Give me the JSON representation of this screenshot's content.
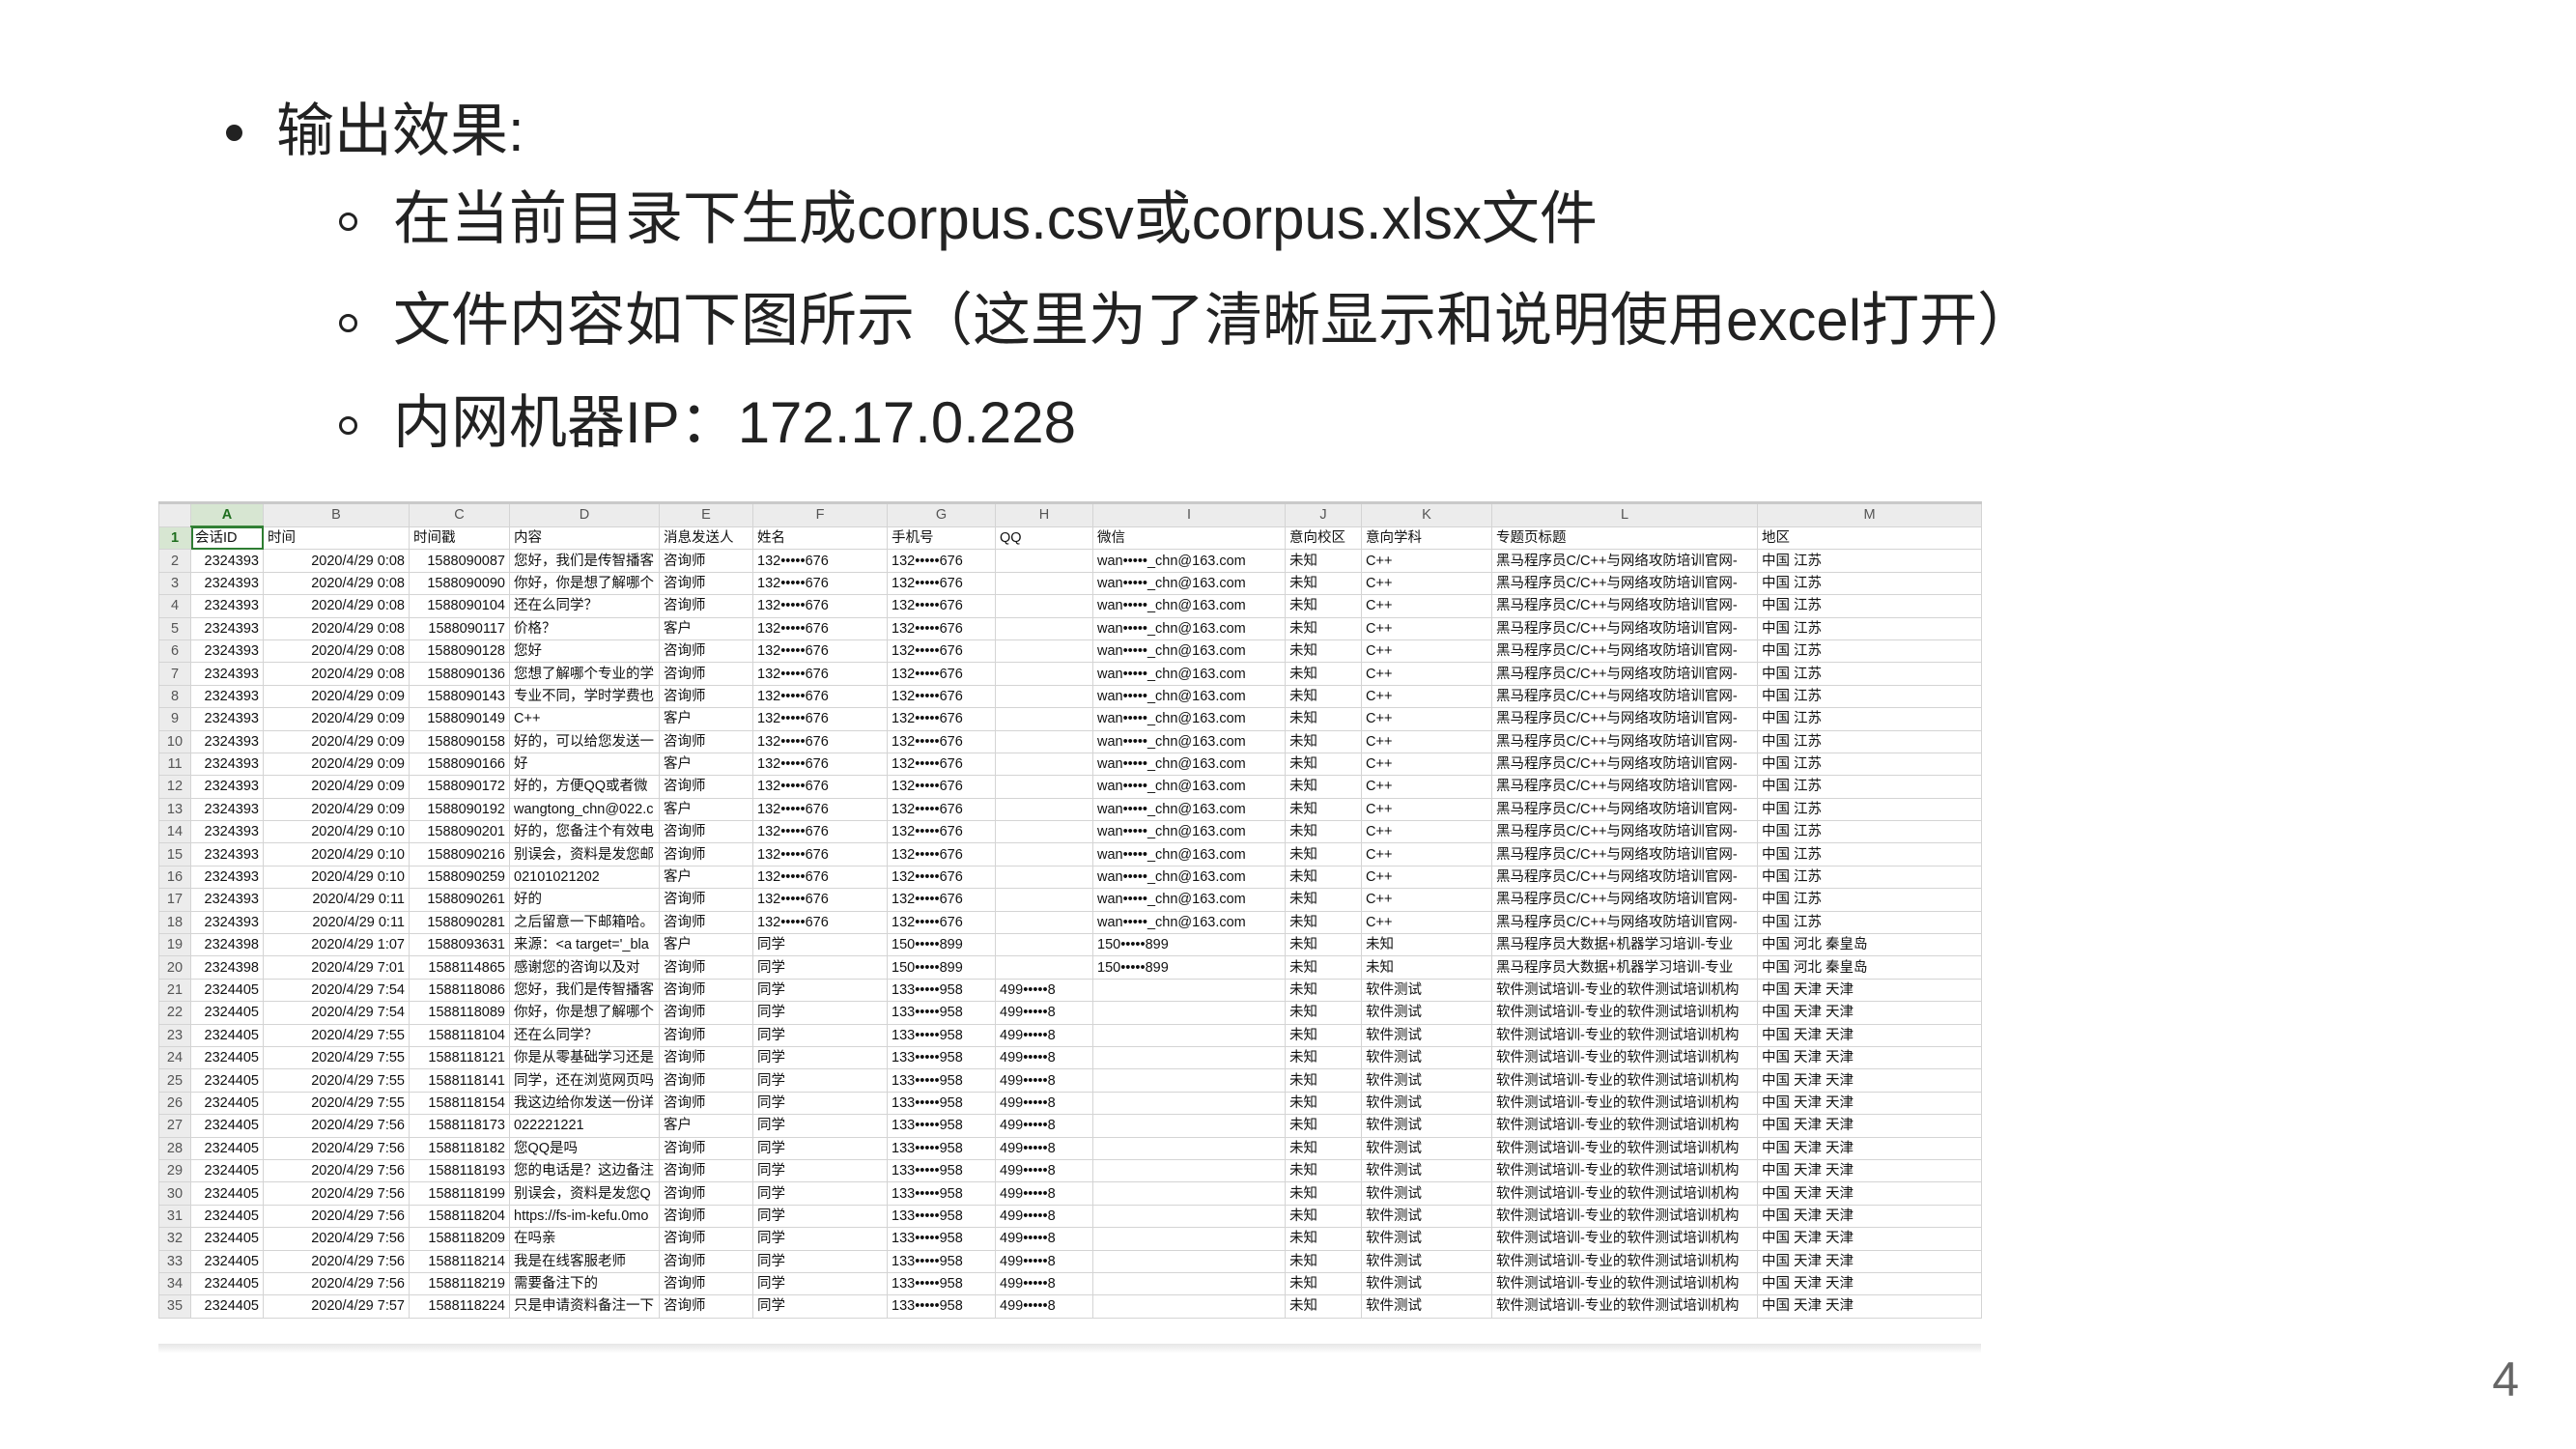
{
  "bullets": {
    "main": "输出效果:",
    "sub": [
      "在当前目录下生成corpus.csv或corpus.xlsx文件",
      "文件内容如下图所示（这里为了清晰显示和说明使用excel打开）",
      "内网机器IP：172.17.0.228"
    ]
  },
  "sheet": {
    "col_letters": [
      "A",
      "B",
      "C",
      "D",
      "E",
      "F",
      "G",
      "H",
      "I",
      "J",
      "K",
      "L",
      "M"
    ],
    "headers": [
      "会话ID",
      "时间",
      "时间戳",
      "内容",
      "消息发送人",
      "姓名",
      "手机号",
      "QQ",
      "微信",
      "意向校区",
      "意向学科",
      "专题页标题",
      "地区"
    ],
    "rows": [
      [
        "2324393",
        "2020/4/29 0:08",
        "1588090087",
        "您好，我们是传智播客",
        "咨询师",
        "132•••••676",
        "132•••••676",
        "",
        "wan•••••_chn@163.com",
        "未知",
        "C++",
        "黑马程序员C/C++与网络攻防培训官网-",
        "中国 江苏"
      ],
      [
        "2324393",
        "2020/4/29 0:08",
        "1588090090",
        "你好，你是想了解哪个",
        "咨询师",
        "132•••••676",
        "132•••••676",
        "",
        "wan•••••_chn@163.com",
        "未知",
        "C++",
        "黑马程序员C/C++与网络攻防培训官网-",
        "中国 江苏"
      ],
      [
        "2324393",
        "2020/4/29 0:08",
        "1588090104",
        "还在么同学？",
        "咨询师",
        "132•••••676",
        "132•••••676",
        "",
        "wan•••••_chn@163.com",
        "未知",
        "C++",
        "黑马程序员C/C++与网络攻防培训官网-",
        "中国 江苏"
      ],
      [
        "2324393",
        "2020/4/29 0:08",
        "1588090117",
        "价格？",
        "客户",
        "132•••••676",
        "132•••••676",
        "",
        "wan•••••_chn@163.com",
        "未知",
        "C++",
        "黑马程序员C/C++与网络攻防培训官网-",
        "中国 江苏"
      ],
      [
        "2324393",
        "2020/4/29 0:08",
        "1588090128",
        "您好",
        "咨询师",
        "132•••••676",
        "132•••••676",
        "",
        "wan•••••_chn@163.com",
        "未知",
        "C++",
        "黑马程序员C/C++与网络攻防培训官网-",
        "中国 江苏"
      ],
      [
        "2324393",
        "2020/4/29 0:08",
        "1588090136",
        "您想了解哪个专业的学",
        "咨询师",
        "132•••••676",
        "132•••••676",
        "",
        "wan•••••_chn@163.com",
        "未知",
        "C++",
        "黑马程序员C/C++与网络攻防培训官网-",
        "中国 江苏"
      ],
      [
        "2324393",
        "2020/4/29 0:09",
        "1588090143",
        "专业不同，学时学费也",
        "咨询师",
        "132•••••676",
        "132•••••676",
        "",
        "wan•••••_chn@163.com",
        "未知",
        "C++",
        "黑马程序员C/C++与网络攻防培训官网-",
        "中国 江苏"
      ],
      [
        "2324393",
        "2020/4/29 0:09",
        "1588090149",
        "C++",
        "客户",
        "132•••••676",
        "132•••••676",
        "",
        "wan•••••_chn@163.com",
        "未知",
        "C++",
        "黑马程序员C/C++与网络攻防培训官网-",
        "中国 江苏"
      ],
      [
        "2324393",
        "2020/4/29 0:09",
        "1588090158",
        "好的，可以给您发送一",
        "咨询师",
        "132•••••676",
        "132•••••676",
        "",
        "wan•••••_chn@163.com",
        "未知",
        "C++",
        "黑马程序员C/C++与网络攻防培训官网-",
        "中国 江苏"
      ],
      [
        "2324393",
        "2020/4/29 0:09",
        "1588090166",
        "好",
        "客户",
        "132•••••676",
        "132•••••676",
        "",
        "wan•••••_chn@163.com",
        "未知",
        "C++",
        "黑马程序员C/C++与网络攻防培训官网-",
        "中国 江苏"
      ],
      [
        "2324393",
        "2020/4/29 0:09",
        "1588090172",
        "好的，方便QQ或者微",
        "咨询师",
        "132•••••676",
        "132•••••676",
        "",
        "wan•••••_chn@163.com",
        "未知",
        "C++",
        "黑马程序员C/C++与网络攻防培训官网-",
        "中国 江苏"
      ],
      [
        "2324393",
        "2020/4/29 0:09",
        "1588090192",
        "wangtong_chn@022.c",
        "客户",
        "132•••••676",
        "132•••••676",
        "",
        "wan•••••_chn@163.com",
        "未知",
        "C++",
        "黑马程序员C/C++与网络攻防培训官网-",
        "中国 江苏"
      ],
      [
        "2324393",
        "2020/4/29 0:10",
        "1588090201",
        "好的，您备注个有效电",
        "咨询师",
        "132•••••676",
        "132•••••676",
        "",
        "wan•••••_chn@163.com",
        "未知",
        "C++",
        "黑马程序员C/C++与网络攻防培训官网-",
        "中国 江苏"
      ],
      [
        "2324393",
        "2020/4/29 0:10",
        "1588090216",
        "别误会，资料是发您邮",
        "咨询师",
        "132•••••676",
        "132•••••676",
        "",
        "wan•••••_chn@163.com",
        "未知",
        "C++",
        "黑马程序员C/C++与网络攻防培训官网-",
        "中国 江苏"
      ],
      [
        "2324393",
        "2020/4/29 0:10",
        "1588090259",
        "02101021202",
        "客户",
        "132•••••676",
        "132•••••676",
        "",
        "wan•••••_chn@163.com",
        "未知",
        "C++",
        "黑马程序员C/C++与网络攻防培训官网-",
        "中国 江苏"
      ],
      [
        "2324393",
        "2020/4/29 0:11",
        "1588090261",
        "好的",
        "咨询师",
        "132•••••676",
        "132•••••676",
        "",
        "wan•••••_chn@163.com",
        "未知",
        "C++",
        "黑马程序员C/C++与网络攻防培训官网-",
        "中国 江苏"
      ],
      [
        "2324393",
        "2020/4/29 0:11",
        "1588090281",
        "之后留意一下邮箱哈。",
        "咨询师",
        "132•••••676",
        "132•••••676",
        "",
        "wan•••••_chn@163.com",
        "未知",
        "C++",
        "黑马程序员C/C++与网络攻防培训官网-",
        "中国 江苏"
      ],
      [
        "2324398",
        "2020/4/29 1:07",
        "1588093631",
        "来源：<a target='_bla",
        "客户",
        "同学",
        "150•••••899",
        "",
        "150•••••899",
        "未知",
        "未知",
        "黑马程序员大数据+机器学习培训-专业",
        "中国 河北 秦皇岛"
      ],
      [
        "2324398",
        "2020/4/29 7:01",
        "1588114865",
        "感谢您的咨询以及对",
        "咨询师",
        "同学",
        "150•••••899",
        "",
        "150•••••899",
        "未知",
        "未知",
        "黑马程序员大数据+机器学习培训-专业",
        "中国 河北 秦皇岛"
      ],
      [
        "2324405",
        "2020/4/29 7:54",
        "1588118086",
        "您好，我们是传智播客",
        "咨询师",
        "同学",
        "133•••••958",
        "499•••••8",
        "",
        "未知",
        "软件测试",
        "软件测试培训-专业的软件测试培训机构",
        "中国 天津 天津"
      ],
      [
        "2324405",
        "2020/4/29 7:54",
        "1588118089",
        "你好，你是想了解哪个",
        "咨询师",
        "同学",
        "133•••••958",
        "499•••••8",
        "",
        "未知",
        "软件测试",
        "软件测试培训-专业的软件测试培训机构",
        "中国 天津 天津"
      ],
      [
        "2324405",
        "2020/4/29 7:55",
        "1588118104",
        "还在么同学？",
        "咨询师",
        "同学",
        "133•••••958",
        "499•••••8",
        "",
        "未知",
        "软件测试",
        "软件测试培训-专业的软件测试培训机构",
        "中国 天津 天津"
      ],
      [
        "2324405",
        "2020/4/29 7:55",
        "1588118121",
        "你是从零基础学习还是",
        "咨询师",
        "同学",
        "133•••••958",
        "499•••••8",
        "",
        "未知",
        "软件测试",
        "软件测试培训-专业的软件测试培训机构",
        "中国 天津 天津"
      ],
      [
        "2324405",
        "2020/4/29 7:55",
        "1588118141",
        "同学，还在浏览网页吗",
        "咨询师",
        "同学",
        "133•••••958",
        "499•••••8",
        "",
        "未知",
        "软件测试",
        "软件测试培训-专业的软件测试培训机构",
        "中国 天津 天津"
      ],
      [
        "2324405",
        "2020/4/29 7:55",
        "1588118154",
        "我这边给你发送一份详",
        "咨询师",
        "同学",
        "133•••••958",
        "499•••••8",
        "",
        "未知",
        "软件测试",
        "软件测试培训-专业的软件测试培训机构",
        "中国 天津 天津"
      ],
      [
        "2324405",
        "2020/4/29 7:56",
        "1588118173",
        "022221221",
        "客户",
        "同学",
        "133•••••958",
        "499•••••8",
        "",
        "未知",
        "软件测试",
        "软件测试培训-专业的软件测试培训机构",
        "中国 天津 天津"
      ],
      [
        "2324405",
        "2020/4/29 7:56",
        "1588118182",
        "您QQ是吗",
        "咨询师",
        "同学",
        "133•••••958",
        "499•••••8",
        "",
        "未知",
        "软件测试",
        "软件测试培训-专业的软件测试培训机构",
        "中国 天津 天津"
      ],
      [
        "2324405",
        "2020/4/29 7:56",
        "1588118193",
        "您的电话是？这边备注",
        "咨询师",
        "同学",
        "133•••••958",
        "499•••••8",
        "",
        "未知",
        "软件测试",
        "软件测试培训-专业的软件测试培训机构",
        "中国 天津 天津"
      ],
      [
        "2324405",
        "2020/4/29 7:56",
        "1588118199",
        "别误会，资料是发您Q",
        "咨询师",
        "同学",
        "133•••••958",
        "499•••••8",
        "",
        "未知",
        "软件测试",
        "软件测试培训-专业的软件测试培训机构",
        "中国 天津 天津"
      ],
      [
        "2324405",
        "2020/4/29 7:56",
        "1588118204",
        "https://fs-im-kefu.0mo",
        "咨询师",
        "同学",
        "133•••••958",
        "499•••••8",
        "",
        "未知",
        "软件测试",
        "软件测试培训-专业的软件测试培训机构",
        "中国 天津 天津"
      ],
      [
        "2324405",
        "2020/4/29 7:56",
        "1588118209",
        "在吗亲",
        "咨询师",
        "同学",
        "133•••••958",
        "499•••••8",
        "",
        "未知",
        "软件测试",
        "软件测试培训-专业的软件测试培训机构",
        "中国 天津 天津"
      ],
      [
        "2324405",
        "2020/4/29 7:56",
        "1588118214",
        "我是在线客服老师",
        "咨询师",
        "同学",
        "133•••••958",
        "499•••••8",
        "",
        "未知",
        "软件测试",
        "软件测试培训-专业的软件测试培训机构",
        "中国 天津 天津"
      ],
      [
        "2324405",
        "2020/4/29 7:56",
        "1588118219",
        "需要备注下的",
        "咨询师",
        "同学",
        "133•••••958",
        "499•••••8",
        "",
        "未知",
        "软件测试",
        "软件测试培训-专业的软件测试培训机构",
        "中国 天津 天津"
      ],
      [
        "2324405",
        "2020/4/29 7:57",
        "1588118224",
        "只是申请资料备注一下",
        "咨询师",
        "同学",
        "133•••••958",
        "499•••••8",
        "",
        "未知",
        "软件测试",
        "软件测试培训-专业的软件测试培训机构",
        "中国 天津 天津"
      ]
    ]
  },
  "page_number": "4"
}
